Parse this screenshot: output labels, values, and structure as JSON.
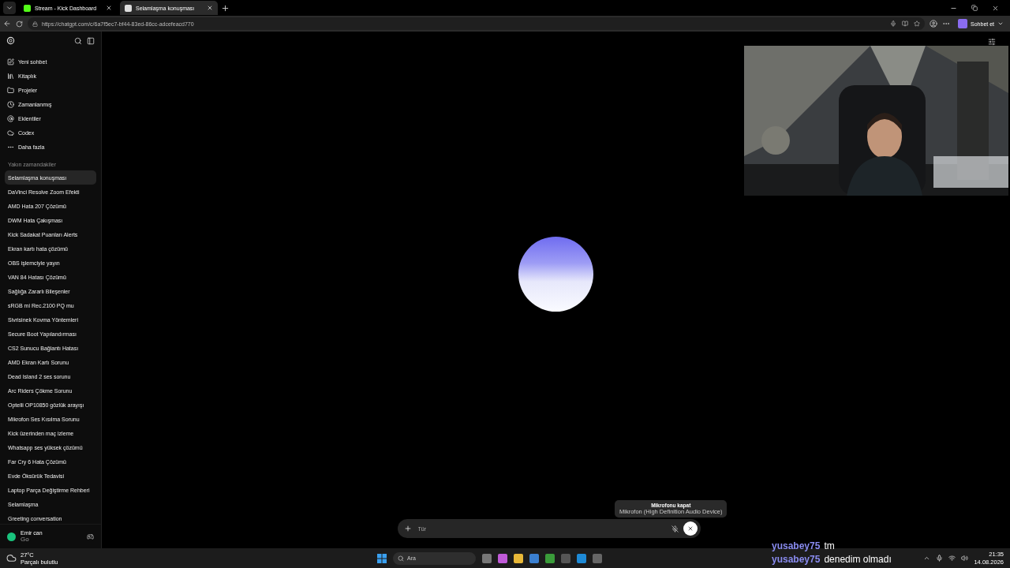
{
  "browser": {
    "tabs": [
      {
        "title": "Stream - Kick Dashboard",
        "selected": false
      },
      {
        "title": "Selamlaşma konuşması",
        "selected": true
      }
    ],
    "url": "https://chatgpt.com/c/6a7f5ec7-bf44-83ed-86cc-adcefeacd770",
    "copilot_label": "Sohbet et"
  },
  "sidebar": {
    "nav": [
      "Yeni sohbet",
      "Kitaplık",
      "Projeler",
      "Zamanlanmış",
      "Eklentiler",
      "Codex",
      "Daha fazla"
    ],
    "section_title": "Yakın zamandakiler",
    "chats": [
      {
        "title": "Selamlaşma konuşması",
        "selected": true
      },
      {
        "title": "DaVinci Resolve Zoom Efekti",
        "selected": false
      },
      {
        "title": "AMD Hata 207 Çözümü",
        "selected": false
      },
      {
        "title": "DWM Hata Çakışması",
        "selected": false
      },
      {
        "title": "Kick Sadakat Puanları Alerts",
        "selected": false
      },
      {
        "title": "Ekran kartı hata çözümü",
        "selected": false
      },
      {
        "title": "OBS işlemciyle yayın",
        "selected": false
      },
      {
        "title": "VAN 84 Hatası Çözümü",
        "selected": false
      },
      {
        "title": "Sağlığa Zararlı Bileşenler",
        "selected": false
      },
      {
        "title": "sRGB mi Rec.2100 PQ mu",
        "selected": false
      },
      {
        "title": "Sivrisinek Kovma Yöntemleri",
        "selected": false
      },
      {
        "title": "Secure Boot Yapılandırması",
        "selected": false
      },
      {
        "title": "CS2 Sunucu Bağlantı Hatası",
        "selected": false
      },
      {
        "title": "AMD Ekran Kartı Sorunu",
        "selected": false
      },
      {
        "title": "Dead Island 2 ses sorunu",
        "selected": false
      },
      {
        "title": "Arc Riders Çökme Sorunu",
        "selected": false
      },
      {
        "title": "Optelli OP10850 gözlük arayışı",
        "selected": false
      },
      {
        "title": "Mikrofon Ses Kısılma Sorunu",
        "selected": false
      },
      {
        "title": "Kick üzerinden maç izleme",
        "selected": false
      },
      {
        "title": "Whatsapp ses yüksek çözümü",
        "selected": false
      },
      {
        "title": "Far Cry 6 Hata Çözümü",
        "selected": false
      },
      {
        "title": "Evde Öksürük Tedavisi",
        "selected": false
      },
      {
        "title": "Laptop Parça Değiştirme Rehberi",
        "selected": false
      },
      {
        "title": "Selamlaşma",
        "selected": false
      },
      {
        "title": "Greeting conversation",
        "selected": false
      }
    ],
    "user": {
      "name": "Emir can",
      "plan": "Go"
    }
  },
  "composer": {
    "placeholder": "Tür"
  },
  "tooltip": {
    "title": "Mikrofonu kapat",
    "subtitle": "Mikrofon (High Definition Audio Device)"
  },
  "stream_chat": [
    {
      "user": "yusabey75",
      "message": "tm"
    },
    {
      "user": "yusabey75",
      "message": "denedim olmadı"
    }
  ],
  "taskbar": {
    "weather": {
      "temp": "27°C",
      "condition": "Parçalı bulutlu"
    },
    "search_placeholder": "Ara",
    "time": "21:35",
    "date": "14.08.2026"
  }
}
